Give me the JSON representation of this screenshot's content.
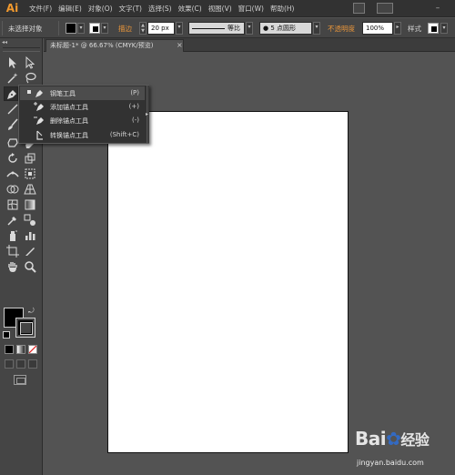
{
  "app": {
    "logo_text": "Ai",
    "brand_color": "#f29a2e"
  },
  "menu": {
    "items": [
      "文件(F)",
      "编辑(E)",
      "对象(O)",
      "文字(T)",
      "选择(S)",
      "效果(C)",
      "视图(V)",
      "窗口(W)",
      "帮助(H)"
    ]
  },
  "control_bar": {
    "selection_status": "未选择对象",
    "stroke_label": "描边",
    "stroke_value": "20 px",
    "stroke_profile": "等比",
    "brush_label": "● 5 点圆形",
    "opacity_label": "不透明度",
    "opacity_value": "100%",
    "style_label": "样式"
  },
  "document_tab": {
    "title": "未标题-1* @ 66.67% (CMYK/预览)",
    "close_glyph": "×"
  },
  "flyout": {
    "items": [
      {
        "label": "钢笔工具",
        "shortcut": "(P)",
        "icon": "pen-icon",
        "selected": true
      },
      {
        "label": "添加锚点工具",
        "shortcut": "(+)",
        "icon": "add-anchor-point-icon",
        "selected": false
      },
      {
        "label": "删除锚点工具",
        "shortcut": "(-)",
        "icon": "delete-anchor-point-icon",
        "selected": false
      },
      {
        "label": "转换锚点工具",
        "shortcut": "(Shift+C)",
        "icon": "convert-anchor-point-icon",
        "selected": false
      }
    ]
  },
  "colors": {
    "fill": "#000000",
    "stroke": "#000000",
    "workspace": "#535353",
    "panel": "#454545",
    "accent_orange": "#e8953a"
  },
  "watermark": {
    "logo_text": "Bai",
    "logo_text_2": "经验",
    "url": "jingyan.baidu.com"
  }
}
